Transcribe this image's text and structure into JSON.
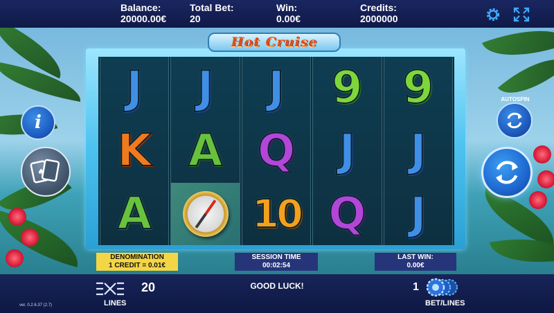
{
  "header": {
    "balance_label": "Balance:",
    "balance_value": "20000.00€",
    "total_bet_label": "Total Bet:",
    "total_bet_value": "20",
    "win_label": "Win:",
    "win_value": "0.00€",
    "credits_label": "Credits:",
    "credits_value": "2000000",
    "icons": [
      "gear-icon",
      "fullscreen-icon"
    ]
  },
  "game": {
    "title": "Hot Cruise",
    "reels": [
      [
        "J",
        "K",
        "A"
      ],
      [
        "J",
        "A",
        "compass"
      ],
      [
        "J",
        "Q",
        "10"
      ],
      [
        "9",
        "J",
        "Q"
      ],
      [
        "9",
        "J",
        "J"
      ]
    ]
  },
  "info_bar": {
    "denomination_label": "DENOMINATION",
    "denomination_value": "1 CREDIT = 0.01€",
    "session_label": "SESSION TIME",
    "session_value": "00:02:54",
    "last_win_label": "LAST WIN:",
    "last_win_value": "0.00€"
  },
  "footer": {
    "lines_value": "20",
    "lines_label": "LINES",
    "message": "GOOD LUCK!",
    "bet_value": "1",
    "bet_label": "BET/LINES",
    "version": "ver. 0.2.6.37 (2.7)"
  },
  "side": {
    "info_icon": "i",
    "autospin_label": "AUTOSPIN"
  },
  "colors": {
    "topbar": "#1a2660",
    "frame": "#4cc2f0",
    "denomination_bg": "#f3d645",
    "panel_bg": "#26357a"
  }
}
